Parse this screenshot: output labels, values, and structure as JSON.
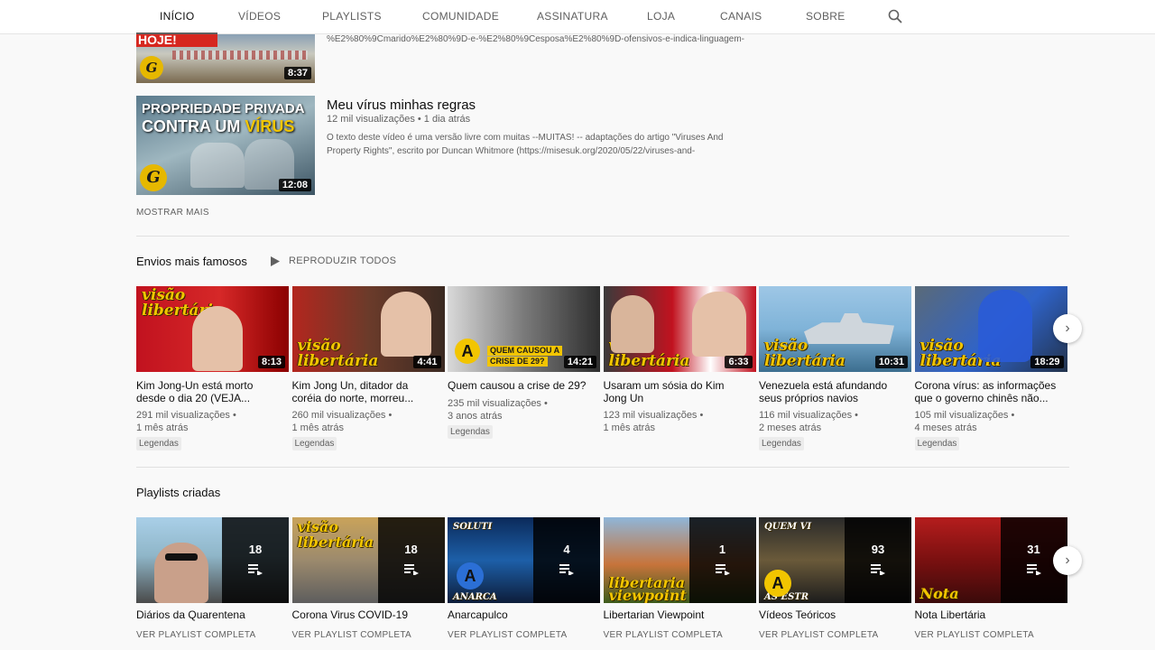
{
  "tabs": [
    {
      "label": "INÍCIO"
    },
    {
      "label": "VÍDEOS"
    },
    {
      "label": "PLAYLISTS"
    },
    {
      "label": "COMUNIDADE"
    },
    {
      "label": "ASSINATURA"
    },
    {
      "label": "LOJA"
    },
    {
      "label": "CANAIS"
    },
    {
      "label": "SOBRE"
    }
  ],
  "top_list": {
    "first": {
      "duration": "8:37",
      "thumb_text": "HOJE!",
      "desc_line": "%E2%80%9Cmarido%E2%80%9D-e-%E2%80%9Cesposa%E2%80%9D-ofensivos-e-indica-linguagem-"
    },
    "second": {
      "title": "Meu vírus minhas regras",
      "meta": "12 mil visualizações • 1 dia atrás",
      "desc1": "O texto deste vídeo é uma versão livre com muitas --MUITAS! -- adaptações do artigo \"Viruses And",
      "desc2": "Property Rights\", escrito por Duncan Whitmore (https://misesuk.org/2020/05/22/viruses-and-",
      "thumb_line1": "PROPRIEDADE PRIVADA",
      "thumb_line2a": "CONTRA UM ",
      "thumb_line2b": "VÍRUS",
      "duration": "12:08"
    },
    "show_more": "MOSTRAR MAIS"
  },
  "popular": {
    "title": "Envios mais famosos",
    "play_all": "REPRODUZIR TODOS",
    "videos": [
      {
        "title1": "Kim Jong-Un está morto",
        "title2": "desde o dia 20 (VEJA...",
        "views": "291 mil visualizações •",
        "age": "1 mês atrás",
        "badge": "Legendas",
        "duration": "8:13",
        "thumb_a": "visão",
        "thumb_b": "libertária"
      },
      {
        "title1": "Kim Jong Un, ditador da",
        "title2": "coréia do norte, morreu...",
        "views": "260 mil visualizações •",
        "age": "1 mês atrás",
        "badge": "Legendas",
        "duration": "4:41",
        "thumb_a": "visão",
        "thumb_b": "libertária"
      },
      {
        "title1": "Quem causou a crise de 29?",
        "title2": "",
        "views": "235 mil visualizações •",
        "age": "3 anos atrás",
        "badge": "Legendas",
        "duration": "14:21",
        "thumb_a": "QUEM CAUSOU A",
        "thumb_b": "CRISE DE 29?"
      },
      {
        "title1": "Usaram um sósia do Kim",
        "title2": "Jong Un",
        "views": "123 mil visualizações •",
        "age": "1 mês atrás",
        "badge": "",
        "duration": "6:33",
        "thumb_a": "visão",
        "thumb_b": "libertária"
      },
      {
        "title1": "Venezuela está afundando",
        "title2": "seus próprios navios",
        "views": "116 mil visualizações •",
        "age": "2 meses atrás",
        "badge": "Legendas",
        "duration": "10:31",
        "thumb_a": "visão",
        "thumb_b": "libertária"
      },
      {
        "title1": "Corona vírus: as informações",
        "title2": "que o governo chinês não...",
        "views": "105 mil visualizações •",
        "age": "4 meses atrás",
        "badge": "Legendas",
        "duration": "18:29",
        "thumb_a": "visão",
        "thumb_b": "libertária"
      }
    ]
  },
  "playlists": {
    "title": "Playlists criadas",
    "view_label": "VER PLAYLIST COMPLETA",
    "items": [
      {
        "name": "Diários da Quarentena",
        "count": "18",
        "thumb_a": "",
        "thumb_b": ""
      },
      {
        "name": "Corona Virus COVID-19",
        "count": "18",
        "thumb_a": "visão",
        "thumb_b": "libertária"
      },
      {
        "name": "Anarcapulco",
        "count": "4",
        "thumb_a": "SOLUTI",
        "thumb_b": "ANARCA"
      },
      {
        "name": "Libertarian Viewpoint",
        "count": "1",
        "thumb_a": "libertaria",
        "thumb_b": "viewpoint"
      },
      {
        "name": "Vídeos Teóricos",
        "count": "93",
        "thumb_a": "QUEM VI",
        "thumb_b": "AS ESTR"
      },
      {
        "name": "Nota Libertária",
        "count": "31",
        "thumb_a": "Nota",
        "thumb_b": ""
      }
    ]
  }
}
